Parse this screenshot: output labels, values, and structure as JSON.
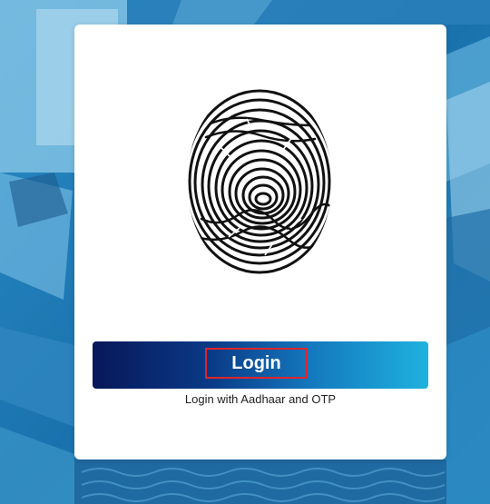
{
  "login": {
    "button_label": "Login",
    "subtext": "Login with Aadhaar and OTP"
  },
  "icons": {
    "main": "fingerprint-icon"
  },
  "colors": {
    "background": "#1b7fb8",
    "card": "#ffffff",
    "gradient_start": "#07175a",
    "gradient_end": "#1eb2de",
    "highlight_border": "#e0242a"
  }
}
